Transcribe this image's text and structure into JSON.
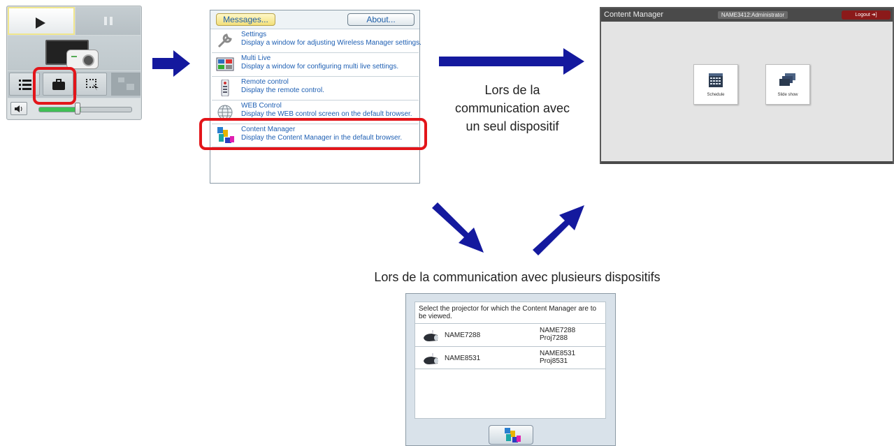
{
  "wireless_manager": {
    "play_icon": "play-icon",
    "pause_icon": "pause-icon",
    "tools": [
      "list-icon",
      "toolbox-icon",
      "selection-icon",
      "multi-display-icon"
    ],
    "volume_icon": "speaker-icon",
    "volume_level": 0.45
  },
  "menu": {
    "messages_label": "Messages...",
    "about_label": "About...",
    "items": [
      {
        "title": "Settings",
        "desc": "Display a window for adjusting Wireless Manager settings.",
        "icon": "wrench-icon"
      },
      {
        "title": "Multi Live",
        "desc": "Display a window for configuring multi live settings.",
        "icon": "multi-live-icon"
      },
      {
        "title": "Remote control",
        "desc": "Display the remote control.",
        "icon": "remote-control-icon"
      },
      {
        "title": "WEB Control",
        "desc": "Display the WEB control screen on the default browser.",
        "icon": "globe-icon"
      },
      {
        "title": "Content Manager",
        "desc": "Display the Content Manager in the default browser.",
        "icon": "content-manager-icon"
      }
    ]
  },
  "content_manager": {
    "title": "Content Manager",
    "user": "NAME3412:Administrator",
    "logout": "Logout",
    "tiles": [
      {
        "label": "Schedule",
        "icon": "calendar-icon"
      },
      {
        "label": "Slide show",
        "icon": "slides-icon"
      }
    ]
  },
  "captions": {
    "single_line1": "Lors de la",
    "single_line2": "communication avec",
    "single_line3": "un seul dispositif",
    "multiple": "Lors de la communication avec plusieurs dispositifs"
  },
  "selector": {
    "prompt": "Select the projector for which the Content Manager are to be viewed.",
    "rows": [
      {
        "name": "NAME7288",
        "detail1": "NAME7288",
        "detail2": "Proj7288"
      },
      {
        "name": "NAME8531",
        "detail1": "NAME8531",
        "detail2": "Proj8531"
      }
    ],
    "ok_icon": "content-manager-icon"
  },
  "colors": {
    "arrow": "#14199e",
    "highlight": "#e3151a",
    "link_text": "#1e5fb3"
  }
}
